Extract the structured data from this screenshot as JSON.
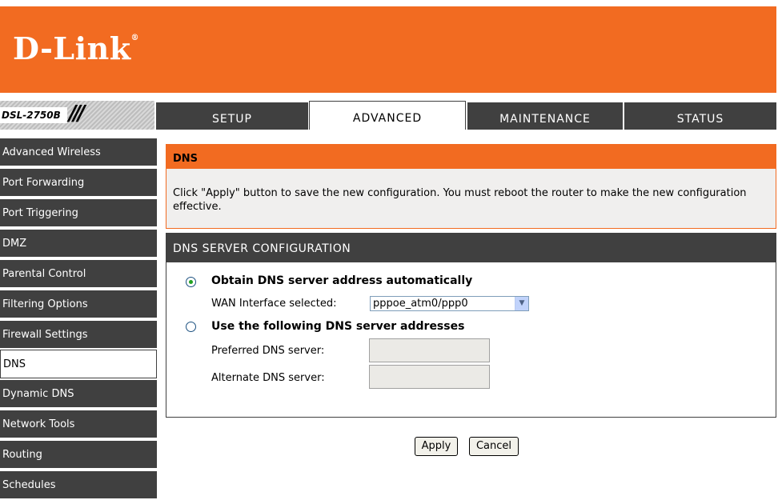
{
  "brand": {
    "logo": "D-Link",
    "trademark": "®",
    "model": "DSL-2750B"
  },
  "tabs": [
    {
      "label": "SETUP",
      "active": false
    },
    {
      "label": "ADVANCED",
      "active": true
    },
    {
      "label": "MAINTENANCE",
      "active": false
    },
    {
      "label": "STATUS",
      "active": false
    }
  ],
  "sidebar": {
    "items": [
      {
        "label": "Advanced Wireless"
      },
      {
        "label": "Port Forwarding"
      },
      {
        "label": "Port Triggering"
      },
      {
        "label": "DMZ"
      },
      {
        "label": "Parental Control"
      },
      {
        "label": "Filtering Options"
      },
      {
        "label": "Firewall Settings"
      },
      {
        "label": "DNS",
        "active": true
      },
      {
        "label": "Dynamic DNS"
      },
      {
        "label": "Network Tools"
      },
      {
        "label": "Routing"
      },
      {
        "label": "Schedules"
      }
    ]
  },
  "info": {
    "title": "DNS",
    "text": "Click \"Apply\" button to save the new configuration. You must reboot the router to make the new configuration effective."
  },
  "config": {
    "title": "DNS SERVER CONFIGURATION",
    "option_auto": {
      "label": "Obtain DNS server address automatically",
      "checked": true
    },
    "wan_label": "WAN Interface selected:",
    "wan_value": "pppoe_atm0/ppp0",
    "option_manual": {
      "label": "Use the following DNS server addresses",
      "checked": false
    },
    "preferred_label": "Preferred DNS server:",
    "preferred_value": "",
    "alternate_label": "Alternate DNS server:",
    "alternate_value": ""
  },
  "buttons": {
    "apply": "Apply",
    "cancel": "Cancel"
  },
  "colors": {
    "brand_orange": "#f26b21",
    "dark_gray": "#404040",
    "info_bg": "#f0efee"
  }
}
